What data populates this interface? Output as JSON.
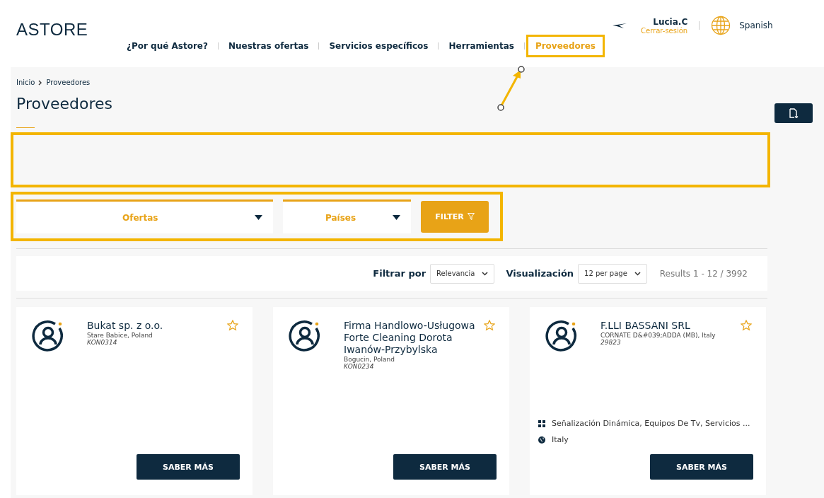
{
  "logo": "ASTORE",
  "nav": [
    {
      "label": "¿Por qué Astore?",
      "selected": false
    },
    {
      "label": "Nuestras ofertas",
      "selected": false
    },
    {
      "label": "Servicios específicos",
      "selected": false
    },
    {
      "label": "Herramientas",
      "selected": false
    },
    {
      "label": "Proveedores",
      "selected": true
    }
  ],
  "user": {
    "name": "Lucia.C",
    "logout": "Cerrar-sesión"
  },
  "language": "Spanish",
  "breadcrumb": [
    "Inicio",
    "Proveedores"
  ],
  "page_title": "Proveedores",
  "filters": [
    {
      "label": "Ofertas"
    },
    {
      "label": "Países"
    }
  ],
  "filter_button": "FILTER",
  "sort": {
    "label": "Filtrar por",
    "value": "Relevancia"
  },
  "view": {
    "label": "Visualización",
    "value": "12 per page"
  },
  "results": "Results 1 - 12 / 3992",
  "cards": [
    {
      "name": "Bukat sp. z o.o.",
      "location": "Stare Babice, Poland",
      "code": "KON0314",
      "button": "SABER MÁS"
    },
    {
      "name": "Firma Handlowo-Usługowa Forte Cleaning Dorota Iwanów-Przybylska",
      "location": "Bogucin, Poland",
      "code": "KON0234",
      "button": "SABER MÁS"
    },
    {
      "name": "F.LLI BASSANI SRL",
      "location": "CORNATE D&#039;ADDA (MB), Italy",
      "code": "29823",
      "categories": "Señalización Dinámica, Equipos De Tv, Servicios ...",
      "country": "Italy",
      "button": "SABER MÁS"
    }
  ]
}
